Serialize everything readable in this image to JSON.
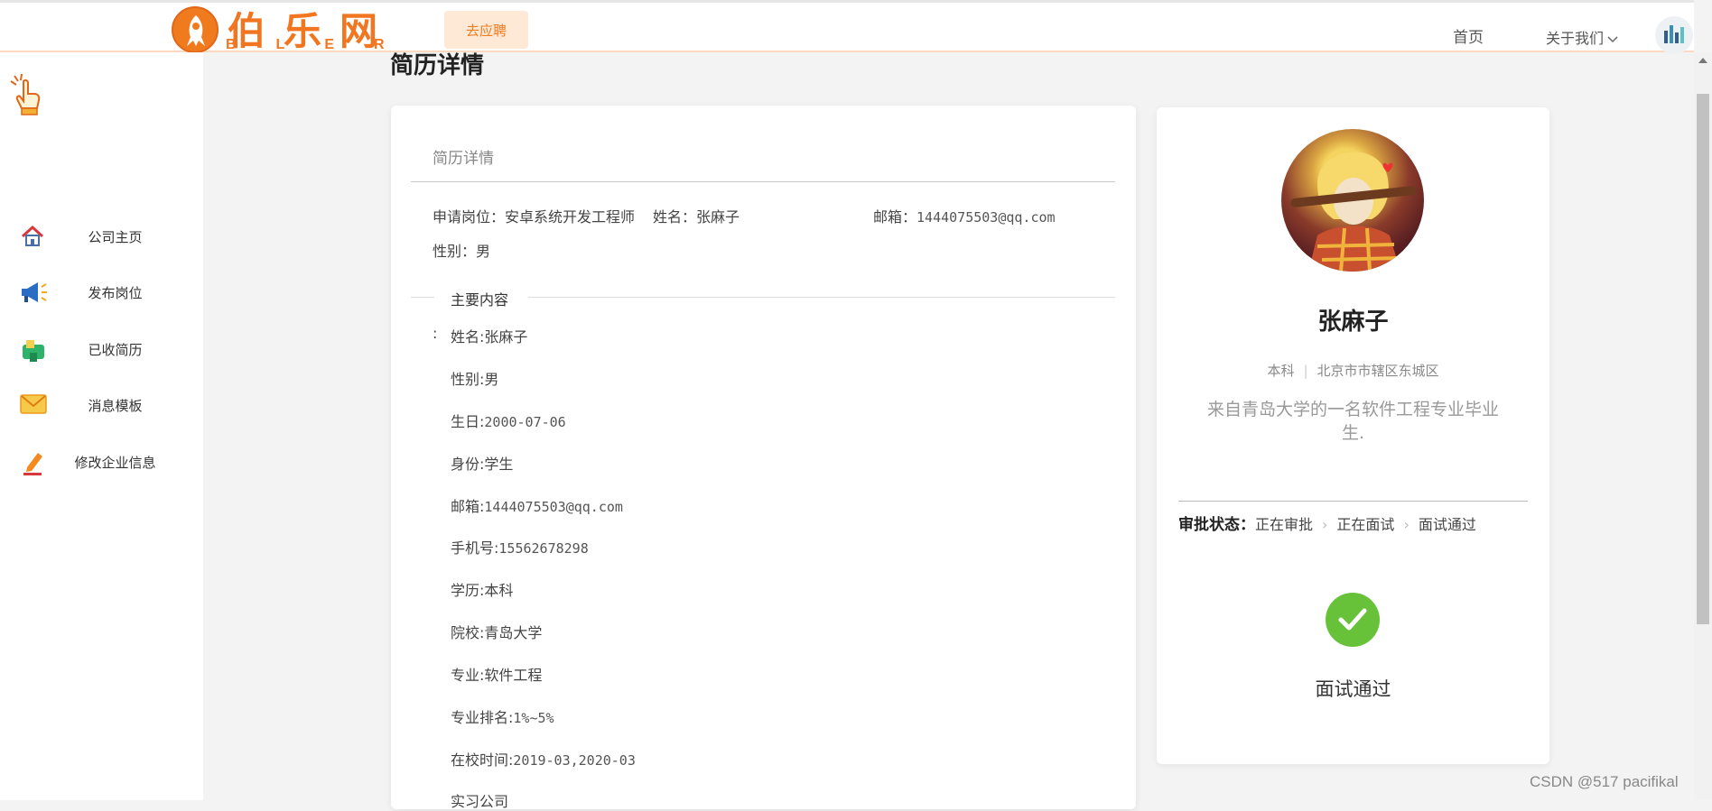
{
  "header": {
    "logo_text": "伯乐网",
    "logo_sub": "BLER",
    "apply_button": "去应聘",
    "nav_home": "首页",
    "nav_about": "关于我们"
  },
  "sidebar": {
    "items": [
      {
        "label": "公司主页",
        "icon": "home-icon"
      },
      {
        "label": "发布岗位",
        "icon": "megaphone-icon"
      },
      {
        "label": "已收简历",
        "icon": "mailbox-icon"
      },
      {
        "label": "消息模板",
        "icon": "envelope-icon"
      },
      {
        "label": "修改企业信息",
        "icon": "pencil-icon"
      }
    ]
  },
  "main": {
    "page_title": "简历详情",
    "card_header": "简历详情",
    "position_label": "申请岗位：",
    "position_value": "安卓系统开发工程师",
    "name_label": "姓名：",
    "name_value": "张麻子",
    "email_label": "邮箱：",
    "email_value": "1444075503@qq.com",
    "gender_label": "性别：",
    "gender_value": "男",
    "section_title": "主要内容",
    "leading_colon": ":",
    "content_lines": [
      {
        "label": "姓名:",
        "value": "张麻子"
      },
      {
        "label": "性别:",
        "value": "男"
      },
      {
        "label": "生日:",
        "value": "2000-07-06"
      },
      {
        "label": "身份:",
        "value": "学生"
      },
      {
        "label": "邮箱:",
        "value": "1444075503@qq.com"
      },
      {
        "label": "手机号:",
        "value": "15562678298"
      },
      {
        "label": "学历:",
        "value": "本科"
      },
      {
        "label": "院校:",
        "value": "青岛大学"
      },
      {
        "label": "专业:",
        "value": "软件工程"
      },
      {
        "label": "专业排名:",
        "value": "1%~5%"
      },
      {
        "label": "在校时间:",
        "value": "2019-03,2020-03"
      },
      {
        "label": "实习公司",
        "value": ""
      }
    ]
  },
  "profile": {
    "name": "张麻子",
    "degree": "本科",
    "location": "北京市市辖区东城区",
    "bio": "来自青岛大学的一名软件工程专业毕业生.",
    "status_label": "审批状态：",
    "status_steps": [
      "正在审批",
      "正在面试",
      "面试通过"
    ],
    "result": "面试通过",
    "success_color": "#67c23a"
  },
  "watermark": "CSDN @517 pacifikal"
}
